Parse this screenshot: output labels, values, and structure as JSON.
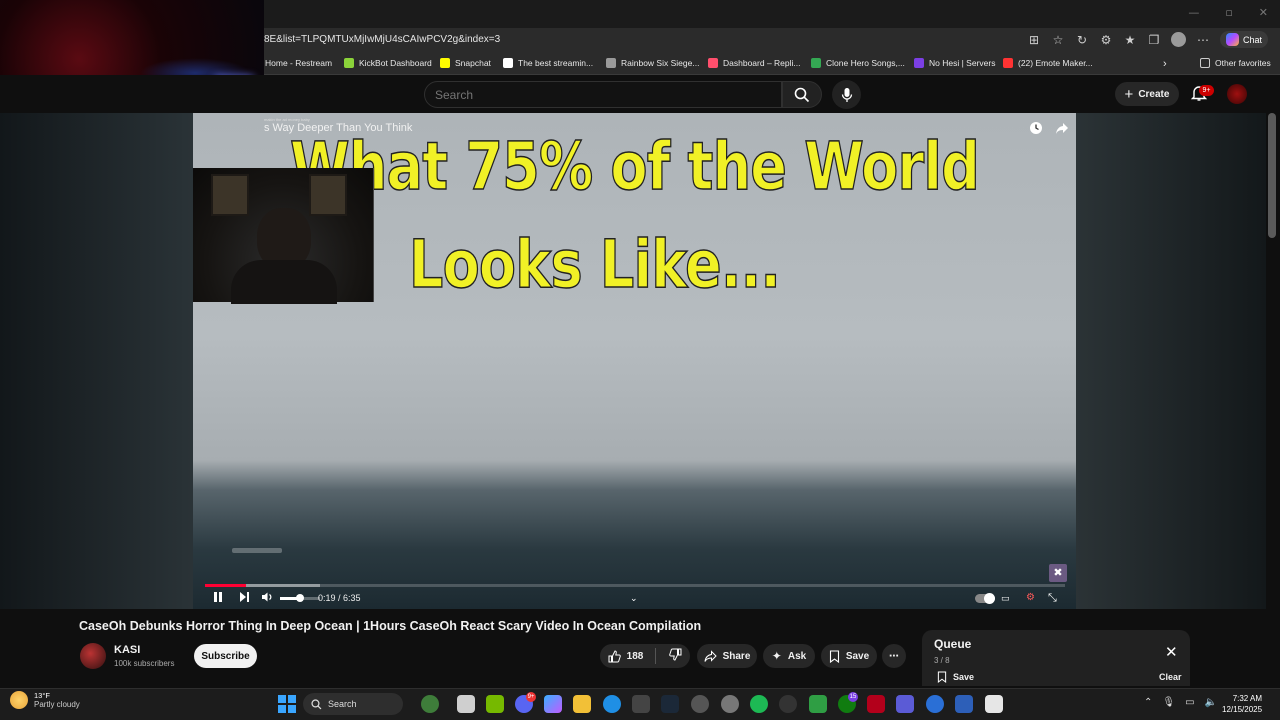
{
  "browser": {
    "url": "8E&list=TLPQMTUxMjIwMjU4sCAIwPCV2g&index=3",
    "chat_label": "Chat",
    "other_favorites": "Other favorites",
    "bookmarks": [
      {
        "label": "Home - Restream",
        "color": "#2a7bff"
      },
      {
        "label": "KickBot Dashboard",
        "color": "#8bd33a"
      },
      {
        "label": "Snapchat",
        "color": "#fffc00"
      },
      {
        "label": "The best streamin...",
        "color": "#ffffff"
      },
      {
        "label": "Rainbow Six Siege...",
        "color": "#9a9a9a"
      },
      {
        "label": "Dashboard – Repli...",
        "color": "#ff4f6d"
      },
      {
        "label": "Clone Hero Songs,...",
        "color": "#34a853"
      },
      {
        "label": "No Hesi | Servers",
        "color": "#7b3fe4"
      },
      {
        "label": "(22) Emote Maker...",
        "color": "#ff3333"
      }
    ]
  },
  "youtube": {
    "search_placeholder": "Search",
    "create_label": "Create",
    "notifications_badge": "9+"
  },
  "player": {
    "overlay_title": "s Way Deeper Than You Think",
    "overlay_tiny": "makin the ad money baby",
    "overlay_line1": "What 75% of the World",
    "overlay_line2": "Looks Like...",
    "current_time": "0:19",
    "duration": "6:35",
    "time_display": "0:19 / 6:35",
    "progress_fraction": 0.048
  },
  "video": {
    "title": "CaseOh Debunks Horror Thing In Deep Ocean | 1Hours CaseOh React Scary Video In Ocean Compilation",
    "channel": "KASI",
    "subscribers": "100k subscribers",
    "subscribe_label": "Subscribe",
    "likes": "188",
    "share_label": "Share",
    "ask_label": "Ask",
    "save_label": "Save"
  },
  "queue": {
    "title": "Queue",
    "count": "3 / 8",
    "save_label": "Save",
    "clear_label": "Clear"
  },
  "taskbar": {
    "temperature": "13°F",
    "weather": "Partly cloudy",
    "search_label": "Search",
    "time": "7:32 AM",
    "date": "12/15/2025",
    "steam_badge": "9+",
    "xbox_badge": "15"
  },
  "colors": {
    "progress": "#ff0033",
    "overlay_text": "#f1f126",
    "background": "#0f0f0f"
  }
}
